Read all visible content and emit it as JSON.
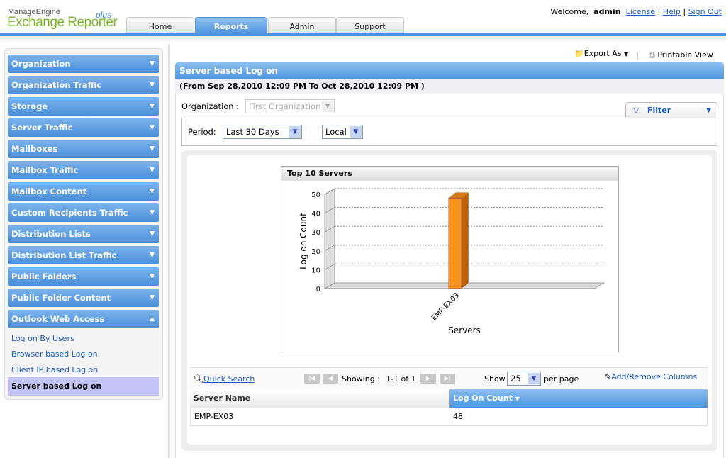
{
  "brand": {
    "line1": "ManageEngine",
    "line2": "Exchange Reporter",
    "plus": "plus"
  },
  "tabs": [
    {
      "label": "Home"
    },
    {
      "label": "Reports",
      "active": true
    },
    {
      "label": "Admin"
    },
    {
      "label": "Support"
    }
  ],
  "header": {
    "welcome": "Welcome,",
    "user": "admin",
    "links": [
      "License",
      "Help",
      "Sign Out"
    ],
    "sep": "|"
  },
  "sidebar": {
    "categories": [
      "Organization",
      "Organization Traffic",
      "Storage",
      "Server Traffic",
      "Mailboxes",
      "Mailbox Traffic",
      "Mailbox Content",
      "Custom Recipients Traffic",
      "Distribution Lists",
      "Distribution List Traffic",
      "Public Folders",
      "Public Folder Content",
      "Outlook Web Access"
    ],
    "sub_items": [
      "Log on By Users",
      "Browser based Log on",
      "Client IP based Log on"
    ],
    "selected": "Server based Log on"
  },
  "toolbar": {
    "export": "Export As",
    "printable": "Printable View"
  },
  "report": {
    "title": "Server based Log on",
    "range": "(From Sep 28,2010 12:09 PM To Oct 28,2010 12:09 PM )",
    "org_label": "Organization :",
    "org_value": "First Organization",
    "filter": "Filter",
    "period_label": "Period:",
    "period_value": "Last 30 Days",
    "tz_value": "Local"
  },
  "chart_data": {
    "type": "bar",
    "title": "Top 10 Servers",
    "categories": [
      "EMP-EX03"
    ],
    "values": [
      48
    ],
    "xlabel": "Servers",
    "ylabel": "Log on Count",
    "ylim": [
      0,
      50
    ],
    "yticks": [
      0,
      10,
      20,
      30,
      40,
      50
    ],
    "color": "#f7941d"
  },
  "table": {
    "quick_search": "Quick Search",
    "showing_label": "Showing :",
    "showing": "1-1 of 1",
    "show": "Show",
    "per_page_value": "25",
    "per_page": "per page",
    "add_remove": "Add/Remove Columns",
    "columns": [
      "Server Name",
      "Log On Count"
    ],
    "rows": [
      [
        "EMP-EX03",
        "48"
      ]
    ]
  }
}
